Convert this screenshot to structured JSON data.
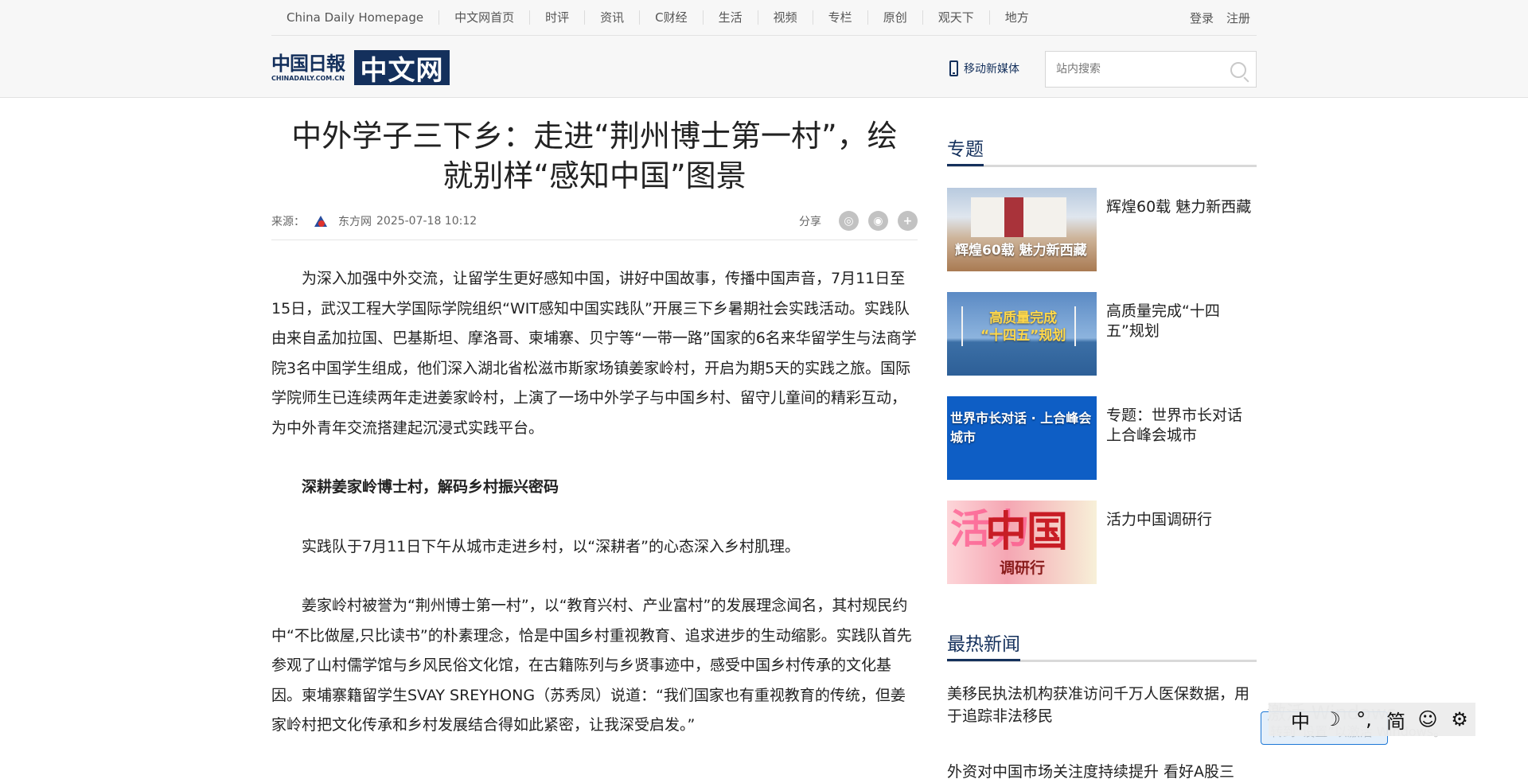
{
  "topnav": {
    "home": "China Daily Homepage",
    "items": [
      "中文网首页",
      "时评",
      "资讯",
      "C财经",
      "生活",
      "视频",
      "专栏",
      "原创",
      "观天下",
      "地方"
    ],
    "login": "登录",
    "register": "注册"
  },
  "header": {
    "logo_cn": "中国日報",
    "logo_en": "CHINADAILY.COM.CN",
    "logo_box": "中文网",
    "mobile": "移动新媒体",
    "search_placeholder": "站内搜索"
  },
  "article": {
    "title": "中外学子三下乡：走进“荆州博士第一村”，绘就别样“感知中国”图景",
    "source_label": "来源：",
    "source": "东方网",
    "date": "2025-07-18 10:12",
    "share_label": "分享",
    "paragraphs": [
      "为深入加强中外交流，让留学生更好感知中国，讲好中国故事，传播中国声音，7月11日至15日，武汉工程大学国际学院组织“WIT感知中国实践队”开展三下乡暑期社会实践活动。实践队由来自孟加拉国、巴基斯坦、摩洛哥、柬埔寨、贝宁等“一带一路”国家的6名来华留学生与法商学院3名中国学生组成，他们深入湖北省松滋市斯家场镇姜家岭村，开启为期5天的实践之旅。国际学院师生已连续两年走进姜家岭村，上演了一场中外学子与中国乡村、留守儿童间的精彩互动，为中外青年交流搭建起沉浸式实践平台。",
      "深耕姜家岭博士村，解码乡村振兴密码",
      "实践队于7月11日下午从城市走进乡村，以“深耕者”的心态深入乡村肌理。",
      "姜家岭村被誉为“荆州博士第一村”，以“教育兴村、产业富村”的发展理念闻名，其村规民约中“不比做屋,只比读书”的朴素理念，恰是中国乡村重视教育、追求进步的生动缩影。实践队首先参观了山村儒学馆与乡风民俗文化馆，在古籍陈列与乡贤事迹中，感受中国乡村传承的文化基因。柬埔寨籍留学生SVAY SREYHONG（苏秀凤）说道：“我们国家也有重视教育的传统，但姜家岭村把文化传承和乡村发展结合得如此紧密，让我深受启发。”"
    ]
  },
  "sidebar": {
    "topics_title": "专题",
    "topics": [
      {
        "title": "辉煌60载 魅力新西藏",
        "thumb_text": "辉煌60载 魅力新西藏"
      },
      {
        "title": "高质量完成“十四五”规划",
        "thumb_text_1": "高质量完成",
        "thumb_text_2": "“十四五”规划"
      },
      {
        "title": "专题：世界市长对话上合峰会城市",
        "thumb_text": "世界市长对话 · 上合峰会城市"
      },
      {
        "title": "活力中国调研行",
        "thumb_big": "中国",
        "thumb_vert": "活力",
        "thumb_sub": "调研行"
      }
    ],
    "hot_title": "最热新闻",
    "hot": [
      "美移民执法机构获准访问千万人医保数据，用于追踪非法移民",
      "外资对中国市场关注度持续提升 看好A股三"
    ]
  },
  "ime": {
    "items": [
      "中",
      "☽",
      "°,",
      "简",
      "☺",
      "⚙"
    ],
    "watermark_1": "激活 Windows",
    "watermark_2": "转到“设置”以激活 Windows。"
  }
}
